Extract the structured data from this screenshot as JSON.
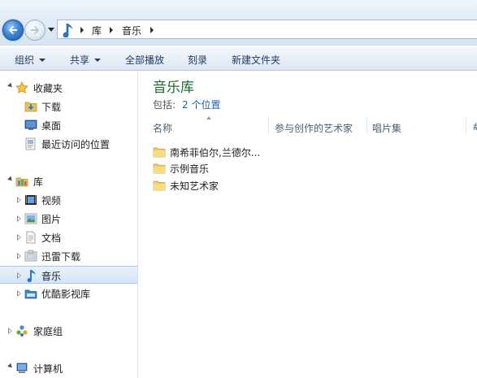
{
  "address": {
    "crumbs": [
      "库",
      "音乐"
    ]
  },
  "toolbar": {
    "organize": "组织",
    "share": "共享",
    "play_all": "全部播放",
    "burn": "刻录",
    "new_folder": "新建文件夹"
  },
  "sidebar": {
    "favorites": {
      "label": "收藏夹",
      "items": [
        {
          "label": "下载",
          "icon": "download-folder-icon"
        },
        {
          "label": "桌面",
          "icon": "desktop-icon"
        },
        {
          "label": "最近访问的位置",
          "icon": "recent-places-icon"
        }
      ]
    },
    "libraries": {
      "label": "库",
      "items": [
        {
          "label": "视频",
          "icon": "videos-icon"
        },
        {
          "label": "图片",
          "icon": "pictures-icon"
        },
        {
          "label": "文档",
          "icon": "documents-icon"
        },
        {
          "label": "迅雷下载",
          "icon": "thunder-download-icon"
        },
        {
          "label": "音乐",
          "icon": "music-icon",
          "selected": true
        },
        {
          "label": "优酷影视库",
          "icon": "youku-library-icon"
        }
      ]
    },
    "homegroup": {
      "label": "家庭组"
    },
    "computer": {
      "label": "计算机"
    }
  },
  "main": {
    "title": "音乐库",
    "includes_label": "包括:",
    "includes_link": "2 个位置",
    "columns": [
      "名称",
      "参与创作的艺术家",
      "唱片集",
      "#"
    ],
    "files": [
      {
        "name": "南希菲伯尔,兰德尔..."
      },
      {
        "name": "示例音乐"
      },
      {
        "name": "未知艺术家"
      }
    ]
  },
  "colors": {
    "title_green": "#1e6b2e",
    "link_blue": "#1f5fb0",
    "selection_blue": "#d4e6fa"
  }
}
